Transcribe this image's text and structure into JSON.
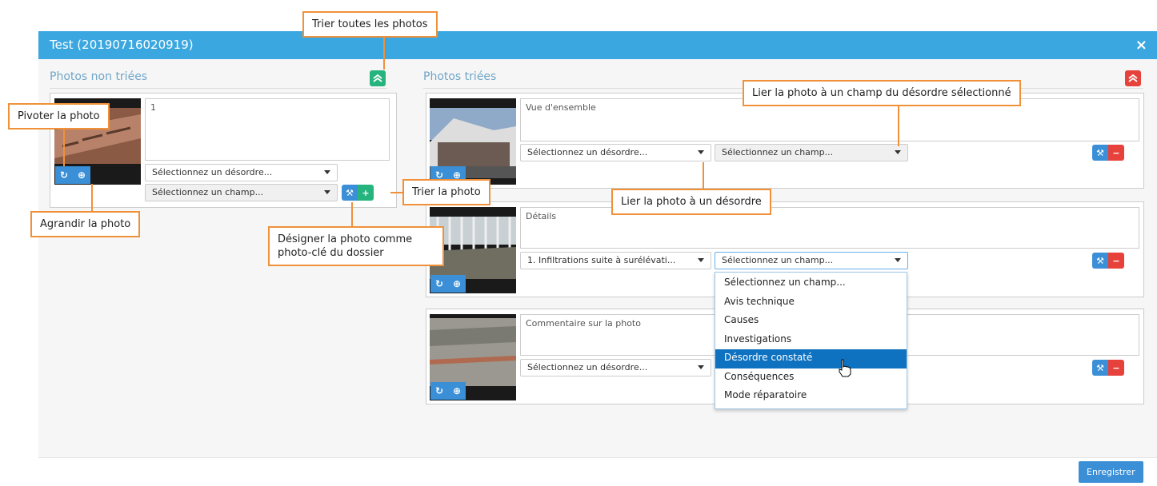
{
  "dialog": {
    "title": "Test (20190716020919)",
    "close_symbol": "×",
    "save_label": "Enregistrer"
  },
  "unsorted": {
    "section_title": "Photos non triées",
    "sort_all_icon": "sort-all-icon",
    "photo": {
      "comment": "1",
      "disorder_placeholder": "Sélectionnez un désordre...",
      "field_placeholder": "Sélectionnez un champ..."
    }
  },
  "sorted": {
    "section_title": "Photos triées",
    "unsort_all_icon": "unsort-all-icon",
    "photos": [
      {
        "comment": "Vue d'ensemble",
        "disorder_value": "Sélectionnez un désordre...",
        "field_value": "Sélectionnez un champ..."
      },
      {
        "comment": "Détails",
        "disorder_value": "1. Infiltrations suite à surélévati...",
        "field_value": "Sélectionnez un champ..."
      },
      {
        "comment": "Commentaire sur la photo",
        "disorder_value": "Sélectionnez un désordre...",
        "field_value": ""
      }
    ],
    "field_dropdown": {
      "options": [
        "Sélectionnez un champ...",
        "Avis technique",
        "Causes",
        "Investigations",
        "Désordre constaté",
        "Conséquences",
        "Mode réparatoire"
      ],
      "highlighted": "Désordre constaté"
    }
  },
  "callouts": {
    "sort_all": "Trier toutes les photos",
    "rotate": "Pivoter la photo",
    "zoom": "Agrandir la photo",
    "sort_photo": "Trier la photo",
    "key_photo": "Désigner la photo comme photo-clé du dossier",
    "link_field": "Lier la photo à un champ du désordre sélectionné",
    "link_disorder": "Lier la photo à un désordre"
  },
  "colors": {
    "header_blue": "#3ba7e0",
    "button_blue": "#3a8fd6",
    "green": "#26b47e",
    "red": "#e6423b",
    "callout_border": "#f0913a",
    "dropdown_highlight": "#0f72c0"
  }
}
